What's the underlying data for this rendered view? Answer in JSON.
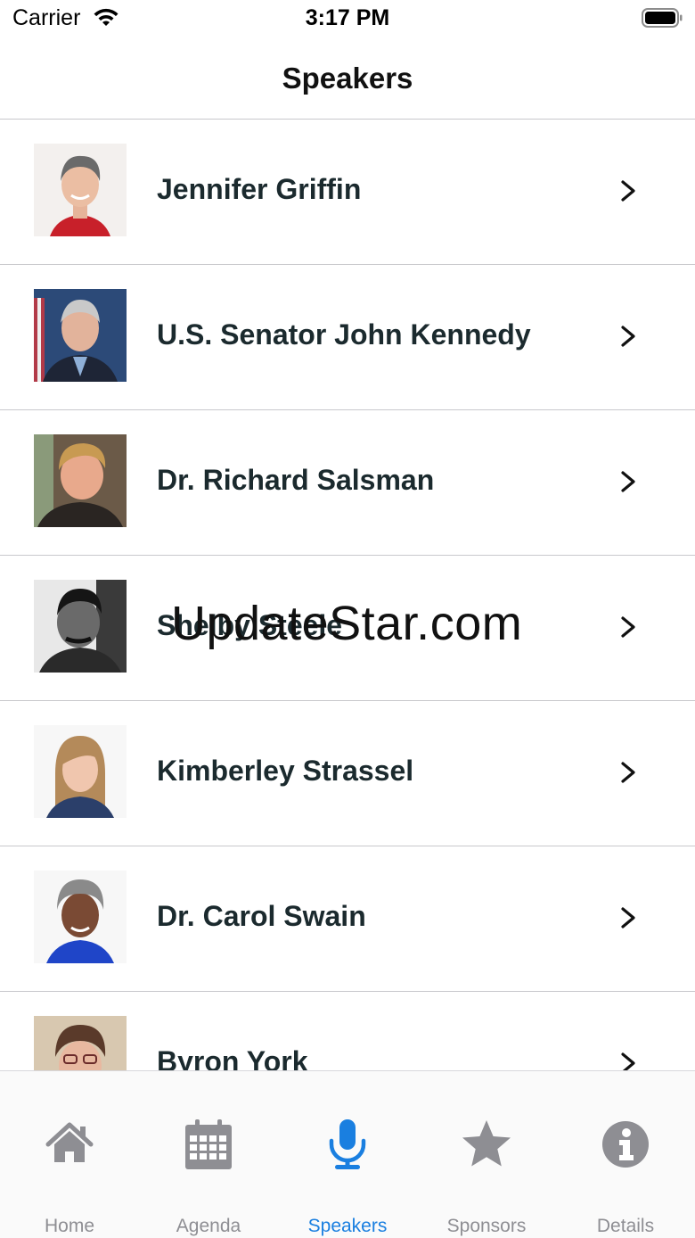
{
  "status_bar": {
    "carrier": "Carrier",
    "time": "3:17 PM"
  },
  "nav": {
    "title": "Speakers"
  },
  "speakers": [
    {
      "name": "Jennifer Griffin"
    },
    {
      "name": "U.S. Senator John Kennedy"
    },
    {
      "name": "Dr. Richard Salsman"
    },
    {
      "name": "Shelby Steele"
    },
    {
      "name": "Kimberley Strassel"
    },
    {
      "name": "Dr. Carol Swain"
    },
    {
      "name": "Byron York"
    }
  ],
  "watermark": "UpdateStar.com",
  "tabs": [
    {
      "label": "Home",
      "icon": "home-icon"
    },
    {
      "label": "Agenda",
      "icon": "calendar-icon"
    },
    {
      "label": "Speakers",
      "icon": "microphone-icon",
      "active": true
    },
    {
      "label": "Sponsors",
      "icon": "star-icon"
    },
    {
      "label": "Details",
      "icon": "info-icon"
    }
  ],
  "colors": {
    "accent": "#1a7fe0",
    "inactive": "#8e8e93",
    "text": "#1b2a2e",
    "separator": "#c8c8cc"
  }
}
